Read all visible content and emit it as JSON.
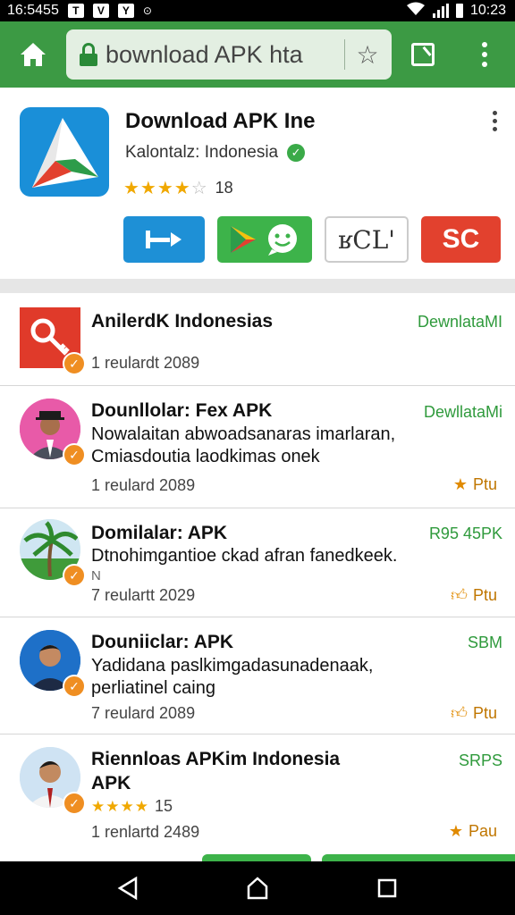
{
  "status_bar": {
    "time": "16:5455",
    "indicator_a": "T",
    "indicator_b": "V",
    "indicator_c": "Y",
    "indicator_d": "⊙",
    "clock_right": "10:23"
  },
  "browser": {
    "url": "bownload APK hta",
    "theme_color": "#3c9a44"
  },
  "app": {
    "title": "Download APK Ine",
    "developer": "Kalontalz: Indonesia",
    "rating_count": "18",
    "stars": 3.5,
    "actions": [
      {
        "label": "⊢▸",
        "color": "#1e90d6"
      },
      {
        "label": "",
        "color": "#3db34a"
      },
      {
        "label": "ʁCL'",
        "color": "#ffffff"
      },
      {
        "label": "SC",
        "color": "#e2412e"
      }
    ]
  },
  "list": [
    {
      "title": "AnilerdK Indonesias",
      "desc": [],
      "meta": "1  reulardt 2089",
      "price": "DewnlataMI",
      "tag": "",
      "tag_icon": ""
    },
    {
      "title": "Dounllolar: Fex APK",
      "desc": [
        "Nowalaitan abwoadsanaras imarlaran,",
        "Cmiasdoutia laodkimas onek"
      ],
      "meta": "1  reulard 2089",
      "price": "DewllataMi",
      "tag": "Ptu",
      "tag_icon": "star-icon"
    },
    {
      "title": "Domilalar: APK",
      "desc": [
        "Dtnohimgantioe ckad afran fanedkeek.",
        "N"
      ],
      "meta": "7  reulartt 2029",
      "price": "R95 45PK",
      "tag": "Ptu",
      "tag_icon": "thumb-icon"
    },
    {
      "title": "Douniiclar: APK",
      "desc": [
        "Yadidana paslkimgadasunadenaak,",
        "perliatinel caing"
      ],
      "meta": "7  reulard 2089",
      "price": "SBM",
      "tag": "Ptu",
      "tag_icon": "thumb-icon"
    },
    {
      "title": "Riennloas APKim Indonesia",
      "title2": "APK",
      "rating_count": "15",
      "meta": "1  renlartd 2489",
      "price": "SRPS",
      "tag": "Pau",
      "tag_icon": "star-icon"
    }
  ]
}
